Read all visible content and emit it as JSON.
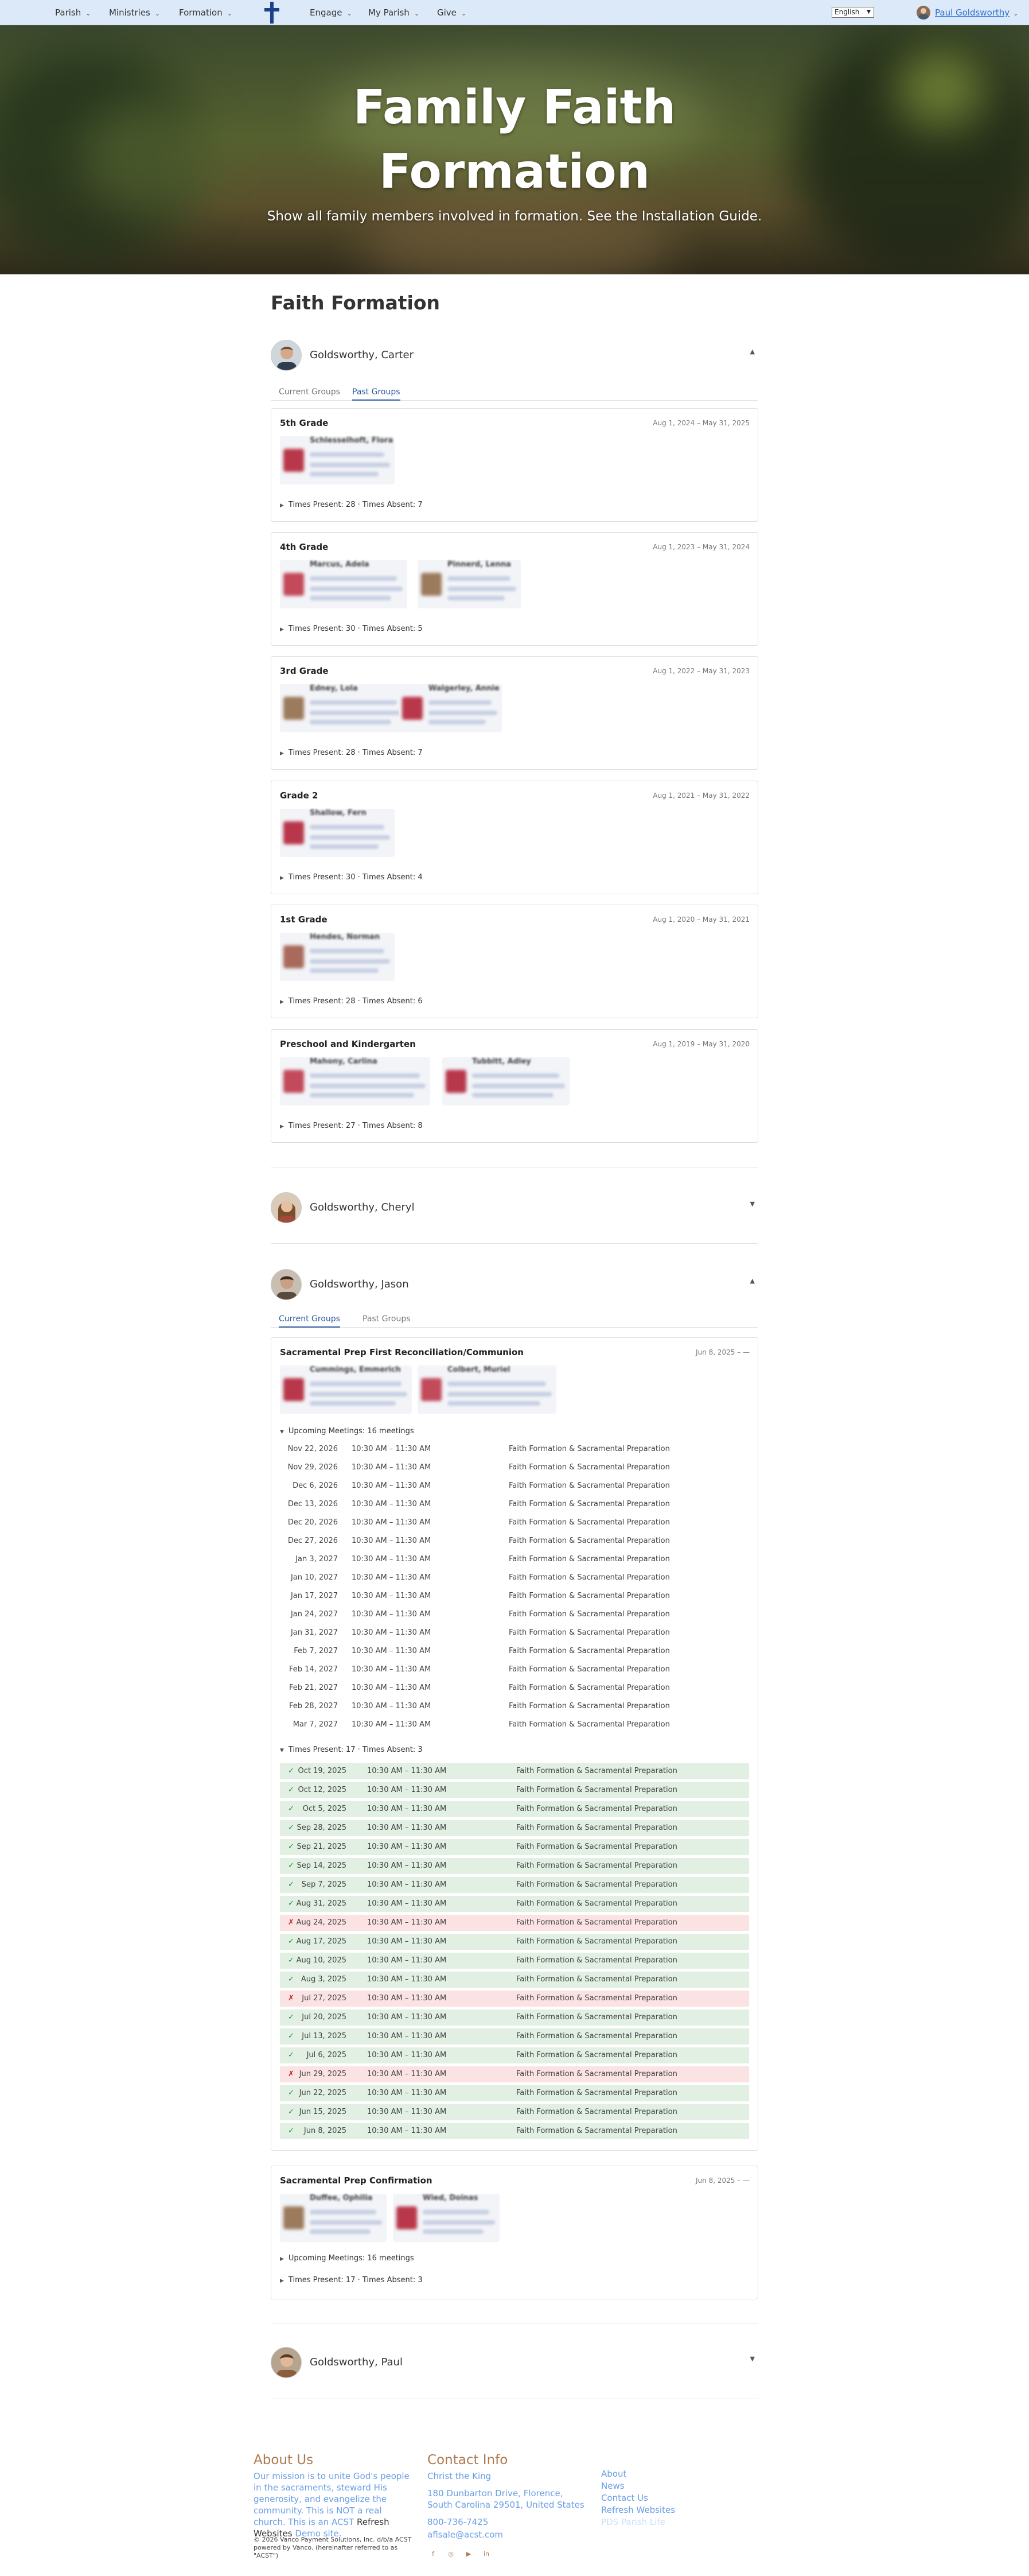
{
  "nav": {
    "items": [
      "Parish",
      "Ministries",
      "Formation",
      "Engage",
      "My Parish",
      "Give"
    ],
    "language": "English",
    "user": "Paul Goldsworthy"
  },
  "hero": {
    "title": "Family Faith Formation",
    "subtitle": "Show all family members involved in formation. See the Installation Guide."
  },
  "page_title": "Faith Formation",
  "tabs": {
    "current": "Current Groups",
    "past": "Past Groups"
  },
  "members": {
    "carter": "Goldsworthy, Carter",
    "cheryl": "Goldsworthy, Cheryl",
    "jason": "Goldsworthy, Jason",
    "paul": "Goldsworthy, Paul"
  },
  "carter_groups": [
    {
      "name": "5th Grade",
      "dates": "Aug 1, 2024 – May 31, 2025",
      "catechists": [
        "Schlesselhoft, Flora"
      ],
      "stats": "Times Present: 28 · Times Absent: 7"
    },
    {
      "name": "4th Grade",
      "dates": "Aug 1, 2023 – May 31, 2024",
      "catechists": [
        "Marcus, Adela",
        "Pinnerd, Lenna"
      ],
      "stats": "Times Present: 30 · Times Absent: 5"
    },
    {
      "name": "3rd Grade",
      "dates": "Aug 1, 2022 – May 31, 2023",
      "catechists": [
        "Edney, Lola",
        "Walgerley, Annie"
      ],
      "stats": "Times Present: 28 · Times Absent: 7"
    },
    {
      "name": "Grade 2",
      "dates": "Aug 1, 2021 – May 31, 2022",
      "catechists": [
        "Shallow, Fern"
      ],
      "stats": "Times Present: 30 · Times Absent: 4"
    },
    {
      "name": "1st Grade",
      "dates": "Aug 1, 2020 – May 31, 2021",
      "catechists": [
        "Hendes, Norman"
      ],
      "stats": "Times Present: 28 · Times Absent: 6"
    },
    {
      "name": "Preschool and Kindergarten",
      "dates": "Aug 1, 2019 – May 31, 2020",
      "catechists": [
        "Mahony, Carlina",
        "Tubbitt, Adley"
      ],
      "stats": "Times Present: 27 · Times Absent: 8"
    }
  ],
  "jason_group1": {
    "name": "Sacramental Prep First Reconciliation/Communion",
    "dates": "Jun 8, 2025 – —",
    "catechists": [
      "Cummings, Emmerich",
      "Colbert, Muriel"
    ],
    "upcoming_label": "Upcoming Meetings: 16 meetings",
    "upcoming": [
      {
        "date": "Nov 22, 2026",
        "time": "10:30 AM – 11:30 AM",
        "title": "Faith Formation & Sacramental Preparation"
      },
      {
        "date": "Nov 29, 2026",
        "time": "10:30 AM – 11:30 AM",
        "title": "Faith Formation & Sacramental Preparation"
      },
      {
        "date": "Dec 6, 2026",
        "time": "10:30 AM – 11:30 AM",
        "title": "Faith Formation & Sacramental Preparation"
      },
      {
        "date": "Dec 13, 2026",
        "time": "10:30 AM – 11:30 AM",
        "title": "Faith Formation & Sacramental Preparation"
      },
      {
        "date": "Dec 20, 2026",
        "time": "10:30 AM – 11:30 AM",
        "title": "Faith Formation & Sacramental Preparation"
      },
      {
        "date": "Dec 27, 2026",
        "time": "10:30 AM – 11:30 AM",
        "title": "Faith Formation & Sacramental Preparation"
      },
      {
        "date": "Jan 3, 2027",
        "time": "10:30 AM – 11:30 AM",
        "title": "Faith Formation & Sacramental Preparation"
      },
      {
        "date": "Jan 10, 2027",
        "time": "10:30 AM – 11:30 AM",
        "title": "Faith Formation & Sacramental Preparation"
      },
      {
        "date": "Jan 17, 2027",
        "time": "10:30 AM – 11:30 AM",
        "title": "Faith Formation & Sacramental Preparation"
      },
      {
        "date": "Jan 24, 2027",
        "time": "10:30 AM – 11:30 AM",
        "title": "Faith Formation & Sacramental Preparation"
      },
      {
        "date": "Jan 31, 2027",
        "time": "10:30 AM – 11:30 AM",
        "title": "Faith Formation & Sacramental Preparation"
      },
      {
        "date": "Feb 7, 2027",
        "time": "10:30 AM – 11:30 AM",
        "title": "Faith Formation & Sacramental Preparation"
      },
      {
        "date": "Feb 14, 2027",
        "time": "10:30 AM – 11:30 AM",
        "title": "Faith Formation & Sacramental Preparation"
      },
      {
        "date": "Feb 21, 2027",
        "time": "10:30 AM – 11:30 AM",
        "title": "Faith Formation & Sacramental Preparation"
      },
      {
        "date": "Feb 28, 2027",
        "time": "10:30 AM – 11:30 AM",
        "title": "Faith Formation & Sacramental Preparation"
      },
      {
        "date": "Mar 7, 2027",
        "time": "10:30 AM – 11:30 AM",
        "title": "Faith Formation & Sacramental Preparation"
      }
    ],
    "stats": "Times Present: 17 · Times Absent: 3",
    "attendance": [
      {
        "mark": "✓",
        "status": "present",
        "date": "Oct 19, 2025",
        "time": "10:30 AM – 11:30 AM",
        "title": "Faith Formation & Sacramental Preparation"
      },
      {
        "mark": "✓",
        "status": "present",
        "date": "Oct 12, 2025",
        "time": "10:30 AM – 11:30 AM",
        "title": "Faith Formation & Sacramental Preparation"
      },
      {
        "mark": "✓",
        "status": "present",
        "date": "Oct 5, 2025",
        "time": "10:30 AM – 11:30 AM",
        "title": "Faith Formation & Sacramental Preparation"
      },
      {
        "mark": "✓",
        "status": "present",
        "date": "Sep 28, 2025",
        "time": "10:30 AM – 11:30 AM",
        "title": "Faith Formation & Sacramental Preparation"
      },
      {
        "mark": "✓",
        "status": "present",
        "date": "Sep 21, 2025",
        "time": "10:30 AM – 11:30 AM",
        "title": "Faith Formation & Sacramental Preparation"
      },
      {
        "mark": "✓",
        "status": "present",
        "date": "Sep 14, 2025",
        "time": "10:30 AM – 11:30 AM",
        "title": "Faith Formation & Sacramental Preparation"
      },
      {
        "mark": "✓",
        "status": "present",
        "date": "Sep 7, 2025",
        "time": "10:30 AM – 11:30 AM",
        "title": "Faith Formation & Sacramental Preparation"
      },
      {
        "mark": "✓",
        "status": "present",
        "date": "Aug 31, 2025",
        "time": "10:30 AM – 11:30 AM",
        "title": "Faith Formation & Sacramental Preparation"
      },
      {
        "mark": "✗",
        "status": "absent",
        "date": "Aug 24, 2025",
        "time": "10:30 AM – 11:30 AM",
        "title": "Faith Formation & Sacramental Preparation"
      },
      {
        "mark": "✓",
        "status": "present",
        "date": "Aug 17, 2025",
        "time": "10:30 AM – 11:30 AM",
        "title": "Faith Formation & Sacramental Preparation"
      },
      {
        "mark": "✓",
        "status": "present",
        "date": "Aug 10, 2025",
        "time": "10:30 AM – 11:30 AM",
        "title": "Faith Formation & Sacramental Preparation"
      },
      {
        "mark": "✓",
        "status": "present",
        "date": "Aug 3, 2025",
        "time": "10:30 AM – 11:30 AM",
        "title": "Faith Formation & Sacramental Preparation"
      },
      {
        "mark": "✗",
        "status": "absent",
        "date": "Jul 27, 2025",
        "time": "10:30 AM – 11:30 AM",
        "title": "Faith Formation & Sacramental Preparation"
      },
      {
        "mark": "✓",
        "status": "present",
        "date": "Jul 20, 2025",
        "time": "10:30 AM – 11:30 AM",
        "title": "Faith Formation & Sacramental Preparation"
      },
      {
        "mark": "✓",
        "status": "present",
        "date": "Jul 13, 2025",
        "time": "10:30 AM – 11:30 AM",
        "title": "Faith Formation & Sacramental Preparation"
      },
      {
        "mark": "✓",
        "status": "present",
        "date": "Jul 6, 2025",
        "time": "10:30 AM – 11:30 AM",
        "title": "Faith Formation & Sacramental Preparation"
      },
      {
        "mark": "✗",
        "status": "absent",
        "date": "Jun 29, 2025",
        "time": "10:30 AM – 11:30 AM",
        "title": "Faith Formation & Sacramental Preparation"
      },
      {
        "mark": "✓",
        "status": "present",
        "date": "Jun 22, 2025",
        "time": "10:30 AM – 11:30 AM",
        "title": "Faith Formation & Sacramental Preparation"
      },
      {
        "mark": "✓",
        "status": "present",
        "date": "Jun 15, 2025",
        "time": "10:30 AM – 11:30 AM",
        "title": "Faith Formation & Sacramental Preparation"
      },
      {
        "mark": "✓",
        "status": "present",
        "date": "Jun 8, 2025",
        "time": "10:30 AM – 11:30 AM",
        "title": "Faith Formation & Sacramental Preparation"
      }
    ]
  },
  "jason_group2": {
    "name": "Sacramental Prep Confirmation",
    "dates": "Jun 8, 2025 – —",
    "catechists": [
      "Duffee, Ophilia",
      "Wied, Doinas"
    ],
    "upcoming_label": "Upcoming Meetings: 16 meetings",
    "stats": "Times Present: 17 · Times Absent: 3"
  },
  "footer": {
    "about_title": "About Us",
    "about_text": "Our mission is to unite God's people in the sacraments, steward His generosity, and evangelize the community.  This is NOT a real church.  This is an ACST",
    "refresh_text": "Refresh Websites",
    "demo_text": "Demo site.",
    "copyright": "© 2026 Vanco Payment Solutions, Inc. d/b/a ACST powered by Vanco. (hereinafter referred to as \"ACST\")",
    "contact_title": "Contact Info",
    "church": "Christ the King",
    "address": "180 Dunbarton Drive, Florence, South Carolina 29501, United States",
    "phone": "800-736-7425",
    "email": "aflsale@acst.com",
    "links": [
      "About",
      "News",
      "Contact Us",
      "Refresh Websites"
    ],
    "faded_link": "PDS Parish Life",
    "social": [
      "f",
      "◎",
      "▶",
      "in"
    ]
  }
}
